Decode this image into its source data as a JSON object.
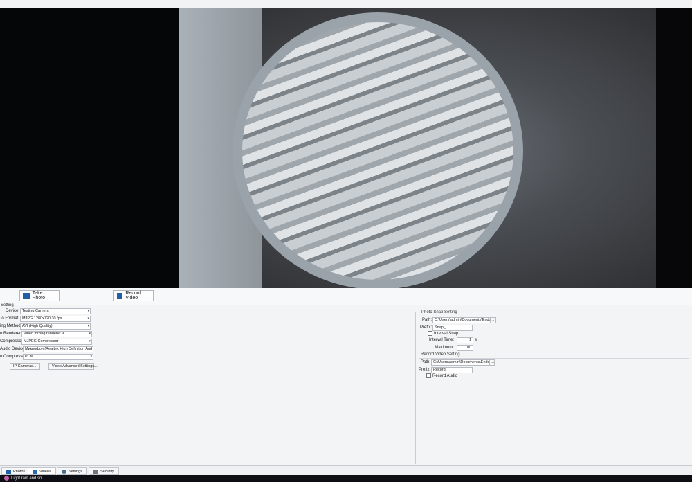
{
  "toolbar": {
    "take_photo": "Take Photo",
    "record_video": "Record Video"
  },
  "left_settings": {
    "group_title": "Setting",
    "device_label": "Device:",
    "device_value": "Testing Camera",
    "format_label": "o Format:",
    "format_value": "MJPG 1280x720 30 fps",
    "method_label": "ing Method:",
    "method_value": "AVI (High Quality)",
    "renderer_label": "o Renderer:",
    "renderer_value": "Video mixing renderer 9",
    "compressor_label": "Compressor:",
    "compressor_value": "MJPEG Compressor",
    "audio_device_label": "Audio Device:",
    "audio_device_value": "Микрофон (Realtek High Definition Aud",
    "audio_compressor_label": "o Compressor:",
    "audio_compressor_value": "PCM",
    "ip_cameras_button": "IP Cameras...",
    "video_advanced_button": "Video Advanced Settings..."
  },
  "photo_snap": {
    "group_title": "Photo Snap Setting",
    "path_label": "Path:",
    "path_value": "C:\\Users\\admin\\Documents\\Endo",
    "prefix_label": "Prefix:",
    "prefix_value": "Snap_",
    "interval_snap_label": "Interval Snap",
    "interval_time_label": "Interval Time:",
    "interval_time_value": "1",
    "interval_unit": "s",
    "maximum_label": "Maximum:",
    "maximum_value": "100"
  },
  "record_video": {
    "group_title": "Record Video Setting",
    "path_label": "Path:",
    "path_value": "C:\\Users\\admin\\Documents\\Endo",
    "prefix_label": "Prefix:",
    "prefix_value": "Record_",
    "record_audio_label": "Record Audio"
  },
  "tabs": [
    {
      "label": "Photos"
    },
    {
      "label": "Videos"
    },
    {
      "label": "Settings"
    },
    {
      "label": "Security"
    }
  ],
  "taskbar": {
    "weather": "Light rain and sn..."
  },
  "colors": {
    "accent": "#1f5fa8",
    "divider": "#a9c3e0"
  }
}
